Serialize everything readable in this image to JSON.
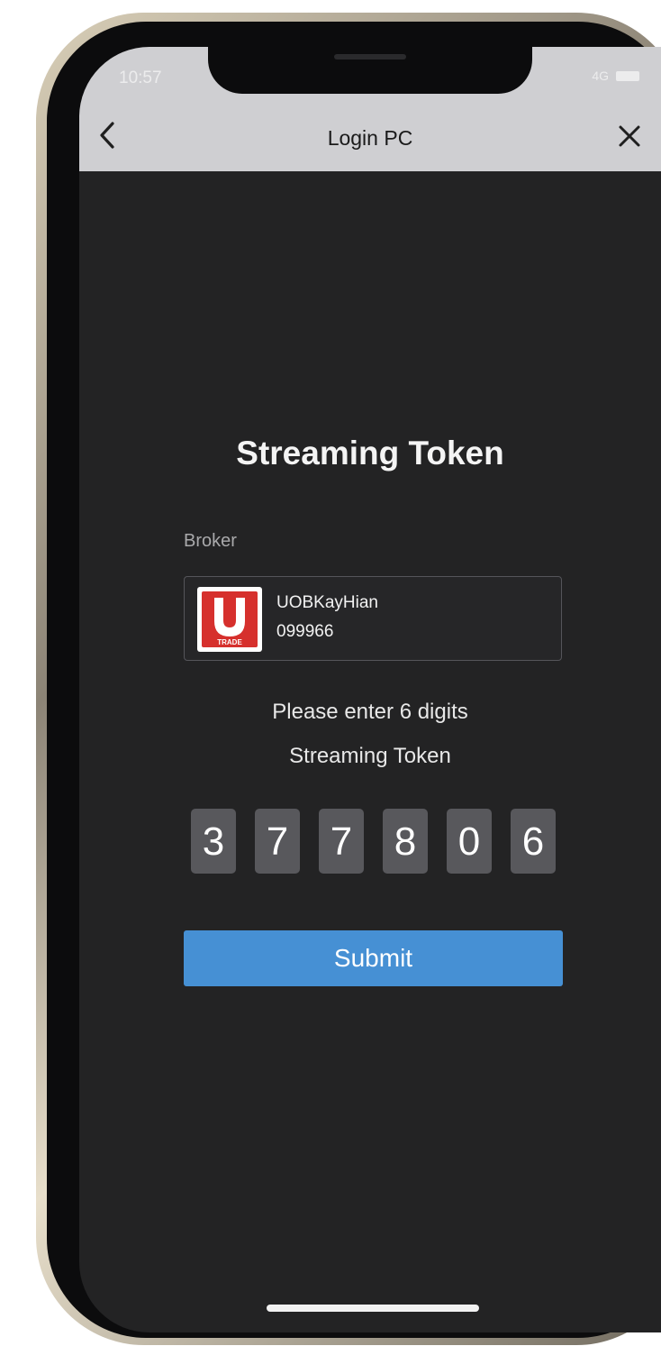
{
  "status_bar": {
    "time": "10:57",
    "network": "4G"
  },
  "nav": {
    "title": "Login PC",
    "back_icon": "chevron-left-icon",
    "close_icon": "close-icon"
  },
  "page": {
    "title": "Streaming Token"
  },
  "broker": {
    "label": "Broker",
    "name": "UOBKayHian",
    "id": "099966",
    "logo_icon": "utrade-logo",
    "logo_text": "TRADE"
  },
  "instructions": {
    "line1": "Please enter 6 digits",
    "line2": "Streaming Token"
  },
  "token": {
    "digits": [
      "3",
      "7",
      "7",
      "8",
      "0",
      "6"
    ]
  },
  "submit": {
    "label": "Submit"
  },
  "colors": {
    "accent": "#4690d4",
    "background": "#232324",
    "header": "#cfcfd2",
    "logo_red": "#d6302d"
  }
}
